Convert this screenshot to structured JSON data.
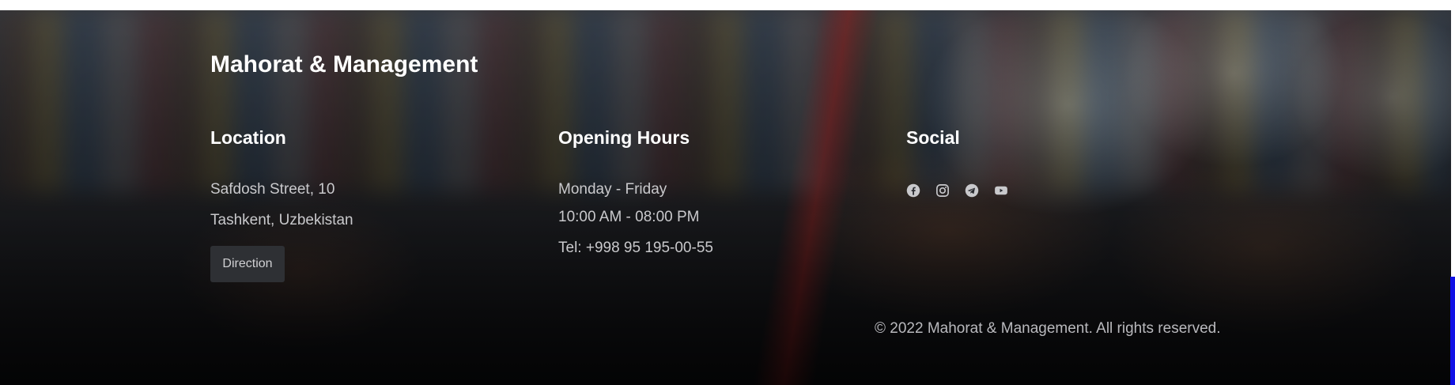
{
  "footer": {
    "brand": "Mahorat & Management",
    "location": {
      "heading": "Location",
      "lines": [
        "Safdosh Street, 10",
        "Tashkent, Uzbekistan"
      ],
      "direction_label": "Direction"
    },
    "hours": {
      "heading": "Opening Hours",
      "lines": [
        "Monday - Friday",
        "10:00 AM - 08:00 PM",
        "Tel: +998 95 195-00-55"
      ]
    },
    "social": {
      "heading": "Social",
      "icons": [
        "facebook-icon",
        "instagram-icon",
        "telegram-icon",
        "youtube-icon"
      ]
    },
    "copyright": "© 2022 Mahorat & Management. All rights reserved."
  },
  "colors": {
    "text_primary": "#ffffff",
    "text_muted": "#c9c9cc",
    "button_bg": "#2e3034",
    "edge_accent": "#1010e6"
  }
}
